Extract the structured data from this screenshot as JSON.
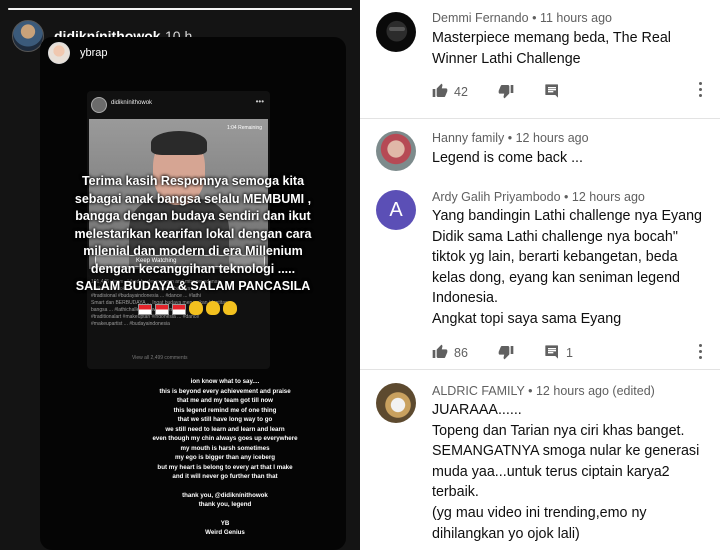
{
  "story": {
    "username": "didiknínithowok",
    "time": "10 h",
    "progress": 1.0,
    "shared": {
      "username": "ybrap",
      "post": {
        "username": "didiknínithowok",
        "remaining": "1:04 Remaining",
        "keep_watching": "Keep Watching",
        "caption": [
          "101,445 views · Liked by devrayngrm and misnoeyadanan",
          "didiknínithowok ... Lathi Challenge ... budaya ...",
          "#tradisional #budayaindonesia ... #dance ... #lathi",
          "Smart dan BERBUDAYA ... Ingat budaya merupakan identitas",
          "bangsa ... #lathichallenge #weirdgenius",
          "#traditionalart #makeuptari #indonesia ... #dance",
          "#makeupartist ... #budayaindonesia"
        ],
        "view_all": "View all 2,499 comments"
      }
    },
    "overlay_lines": [
      "Terima kasih Responnya semoga kita",
      "sebagai anak bangsa selalu MEMBUMI ,",
      "bangga dengan budaya sendiri dan ikut",
      "melestarikan kearifan lokal dengan cara",
      "milenial dan modern di era Millenium",
      "dengan kecanggihan teknologi .....",
      "SALAM BUDAYA & SALAM PANCASILA"
    ],
    "reply_lines": [
      "ion know what to say....",
      "this is beyond every achievement and praise",
      "that me and my team got till now",
      "this legend remind me of one thing",
      "that we still have long way to go",
      "we still need to learn and learn and learn",
      "even though my chin always goes up everywhere",
      "my mouth is harsh sometimes",
      "my ego is bigger than any iceberg",
      "but my heart is belong to every art that I make",
      "and it will never go further than that"
    ],
    "reply_lines_2": [
      "thank you, @didiknínithowok",
      "thank you, legend"
    ],
    "reply_lines_3": [
      "YB",
      "Weird Genius"
    ]
  },
  "comments": [
    {
      "author": "Demmi Fernando",
      "time": "11 hours ago",
      "lines": [
        "Masterpiece memang beda, The Real",
        "Winner Lathi Challenge"
      ],
      "likes": "42",
      "replies": ""
    },
    {
      "author": "Hanny family",
      "time": "12 hours ago",
      "lines": [
        "Legend is come back ..."
      ]
    },
    {
      "author": "Ardy Galih Priyambodo",
      "time": "12 hours ago",
      "avatar_letter": "A",
      "lines": [
        "Yang bandingin Lathi challenge nya Eyang",
        "Didik sama Lathi challenge nya bocah\"",
        "tiktok yg lain, berarti kebangetan, beda",
        "kelas dong, eyang kan seniman legend",
        "Indonesia.",
        "Angkat topi saya sama Eyang"
      ],
      "likes": "86",
      "replies": "1"
    },
    {
      "author": "ALDRIC FAMILY",
      "time": "12 hours ago (edited)",
      "lines": [
        "JUARAAA......",
        "Topeng dan Tarian nya ciri khas banget.",
        "SEMANGATNYA smoga nular ke generasi",
        "muda yaa...untuk terus ciptain karya2",
        "terbaik.",
        "(yg mau video ini trending,emo ny",
        "dihilangkan yo ojok lali)"
      ]
    }
  ],
  "sep": "•",
  "colors": {
    "story_bg": "#141414",
    "text_primary": "#0f0f0f",
    "text_secondary": "#606060",
    "ardy_avatar": "#5b4fb6"
  },
  "icons": [
    "thumb-up-icon",
    "thumb-down-icon",
    "reply-icon",
    "more-vert-icon"
  ]
}
